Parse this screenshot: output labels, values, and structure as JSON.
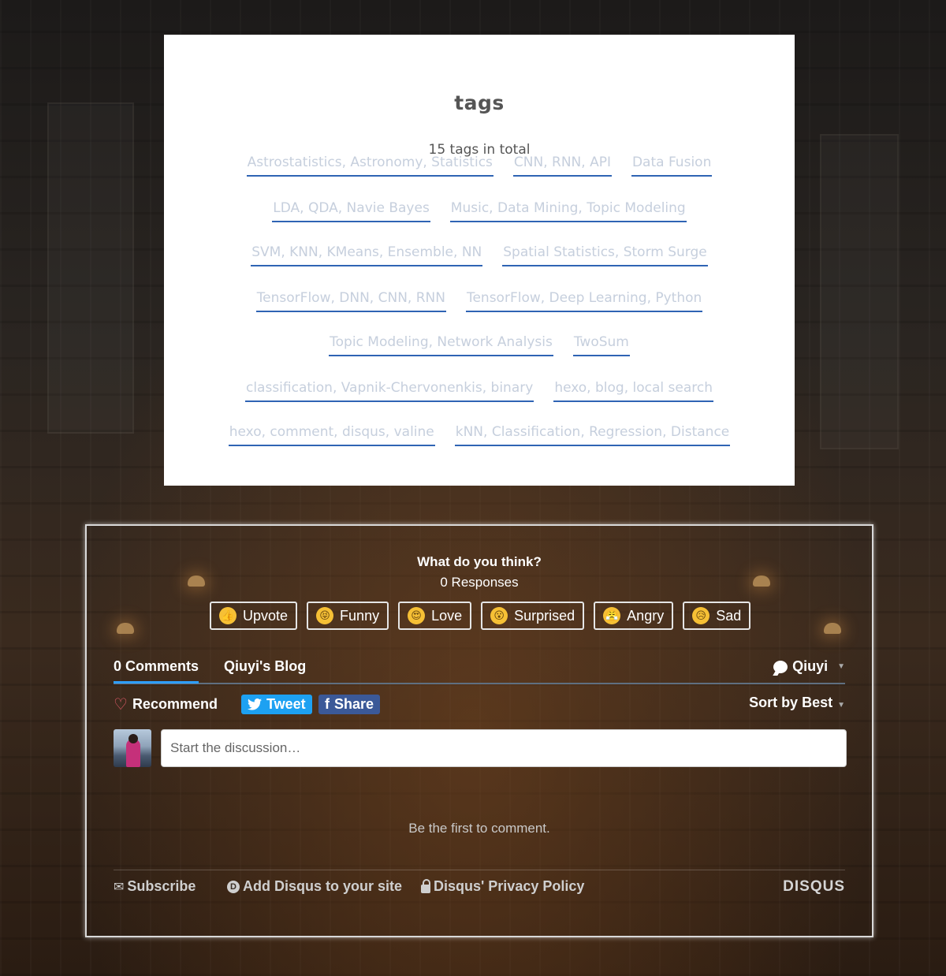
{
  "tags_page": {
    "title": "tags",
    "count_text": "15 tags in total",
    "rows": [
      [
        "Astrostatistics, Astronomy, Statistics",
        "CNN, RNN, API",
        "Data Fusion"
      ],
      [
        "LDA, QDA, Navie Bayes",
        "Music, Data Mining, Topic Modeling"
      ],
      [
        "SVM, KNN, KMeans, Ensemble, NN",
        "Spatial Statistics, Storm Surge"
      ],
      [
        "TensorFlow, DNN, CNN, RNN",
        "TensorFlow, Deep Learning, Python"
      ],
      [
        "Topic Modeling, Network Analysis",
        "TwoSum"
      ],
      [
        "classification, Vapnik-Chervonenkis, binary",
        "hexo, blog, local search"
      ],
      [
        "hexo, comment, disqus, valine",
        "kNN, Classification, Regression, Distance"
      ]
    ]
  },
  "disqus": {
    "question": "What do you think?",
    "responses": "0 Responses",
    "reactions": [
      {
        "label": "Upvote",
        "icon": "thumbs-up-icon",
        "glyph": "👍"
      },
      {
        "label": "Funny",
        "icon": "funny-face-icon",
        "glyph": "😝"
      },
      {
        "label": "Love",
        "icon": "heart-eyes-icon",
        "glyph": "😍"
      },
      {
        "label": "Surprised",
        "icon": "surprised-face-icon",
        "glyph": "😮"
      },
      {
        "label": "Angry",
        "icon": "angry-face-icon",
        "glyph": "😤"
      },
      {
        "label": "Sad",
        "icon": "sad-face-icon",
        "glyph": "😥"
      }
    ],
    "tabs": {
      "comments": "0 Comments",
      "blog": "Qiuyi's Blog"
    },
    "user": "Qiuyi",
    "recommend": "Recommend",
    "tweet": "Tweet",
    "share": "Share",
    "sort": "Sort by Best",
    "input_placeholder": "Start the discussion…",
    "empty_message": "Be the first to comment.",
    "footer": {
      "subscribe": "Subscribe",
      "add": "Add Disqus to your site",
      "privacy": "Disqus' Privacy Policy",
      "brand": "DISQUS"
    },
    "colors": {
      "tab_active": "#2e9fff",
      "tweet": "#1da1f2",
      "share": "#3b5998",
      "tag_underline": "#2f64b4",
      "tag_text": "#c6cfdd"
    }
  }
}
